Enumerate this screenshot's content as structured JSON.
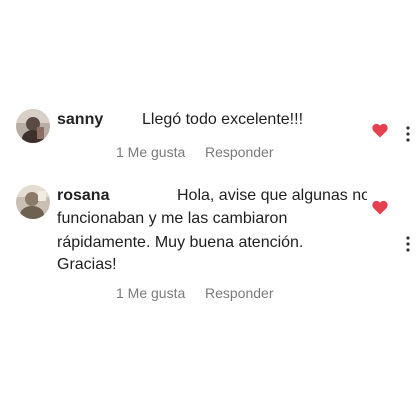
{
  "comments": [
    {
      "username": "sanny",
      "text": "Llegó todo excelente!!!",
      "likes_label": "1 Me gusta",
      "reply_label": "Responder",
      "liked": true,
      "avatar_icon": "user-avatar-icon",
      "heart_icon": "heart-filled-icon",
      "more_icon": "more-vertical-icon"
    },
    {
      "username": "rosana",
      "text_lines": [
        "Hola, avise que algunas no",
        "funcionaban y me las cambiaron",
        "rápidamente.  Muy buena atención.",
        "Gracias!"
      ],
      "likes_label": "1 Me gusta",
      "reply_label": "Responder",
      "liked": true,
      "avatar_icon": "user-avatar-icon",
      "heart_icon": "heart-filled-icon",
      "more_icon": "more-vertical-icon"
    }
  ],
  "colors": {
    "heart": "#e4404f",
    "meta_text": "#7a7a7a",
    "username": "#222222",
    "body_text": "#1f1f1f",
    "more_dots": "#333333"
  }
}
